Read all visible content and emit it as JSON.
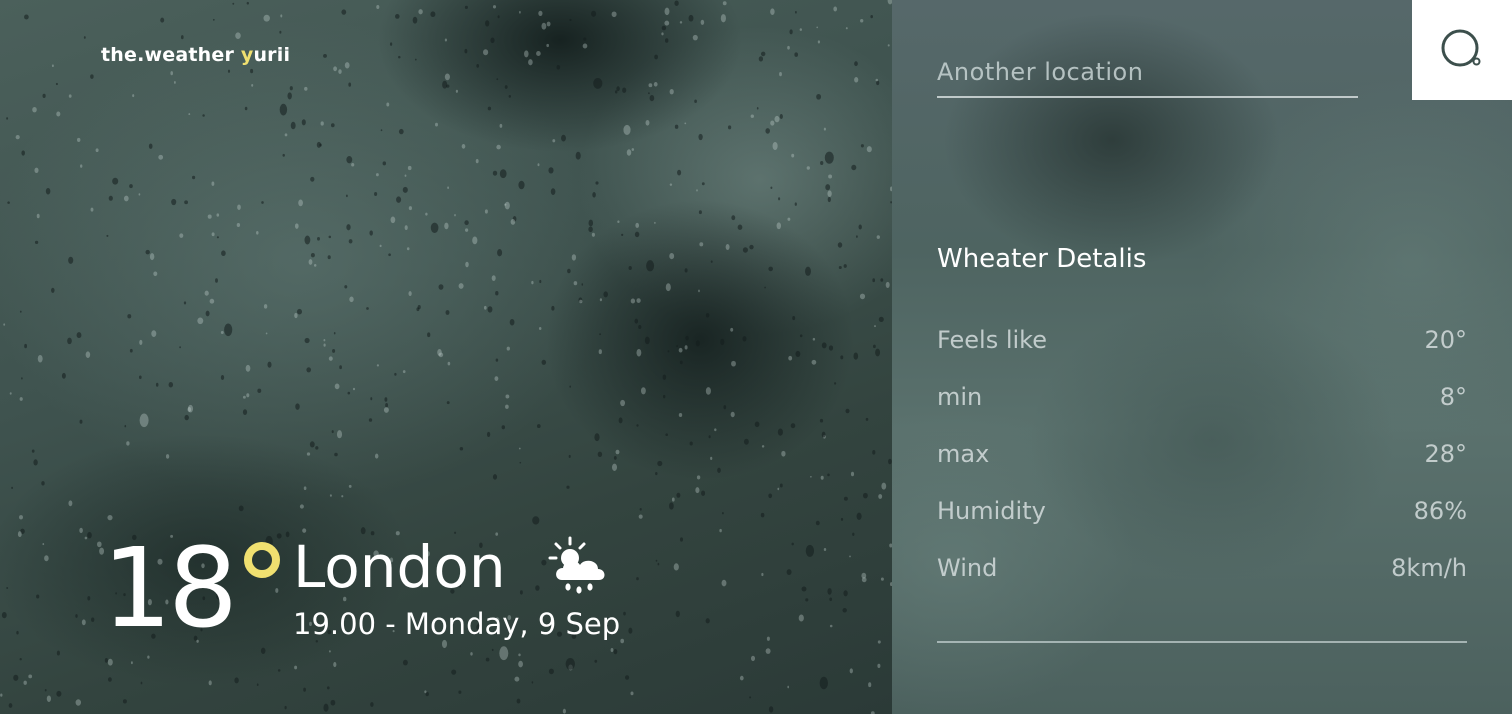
{
  "brand": {
    "prefix": "the.weather ",
    "accent": "y",
    "suffix": "urii",
    "accent_color": "#f0e070"
  },
  "current": {
    "temperature": "18",
    "city": "London",
    "datetime": "19.00 - Monday, 9 Sep",
    "condition_icon": "partly-cloudy-rain-icon"
  },
  "search": {
    "placeholder": "Another location",
    "value": "",
    "button_icon": "search-icon"
  },
  "details": {
    "title": "Wheater Detalis",
    "rows": [
      {
        "label": "Feels like",
        "value": "20°"
      },
      {
        "label": "min",
        "value": "8°"
      },
      {
        "label": "max",
        "value": "28°"
      },
      {
        "label": "Humidity",
        "value": "86%"
      },
      {
        "label": "Wind",
        "value": "8km/h"
      }
    ]
  }
}
